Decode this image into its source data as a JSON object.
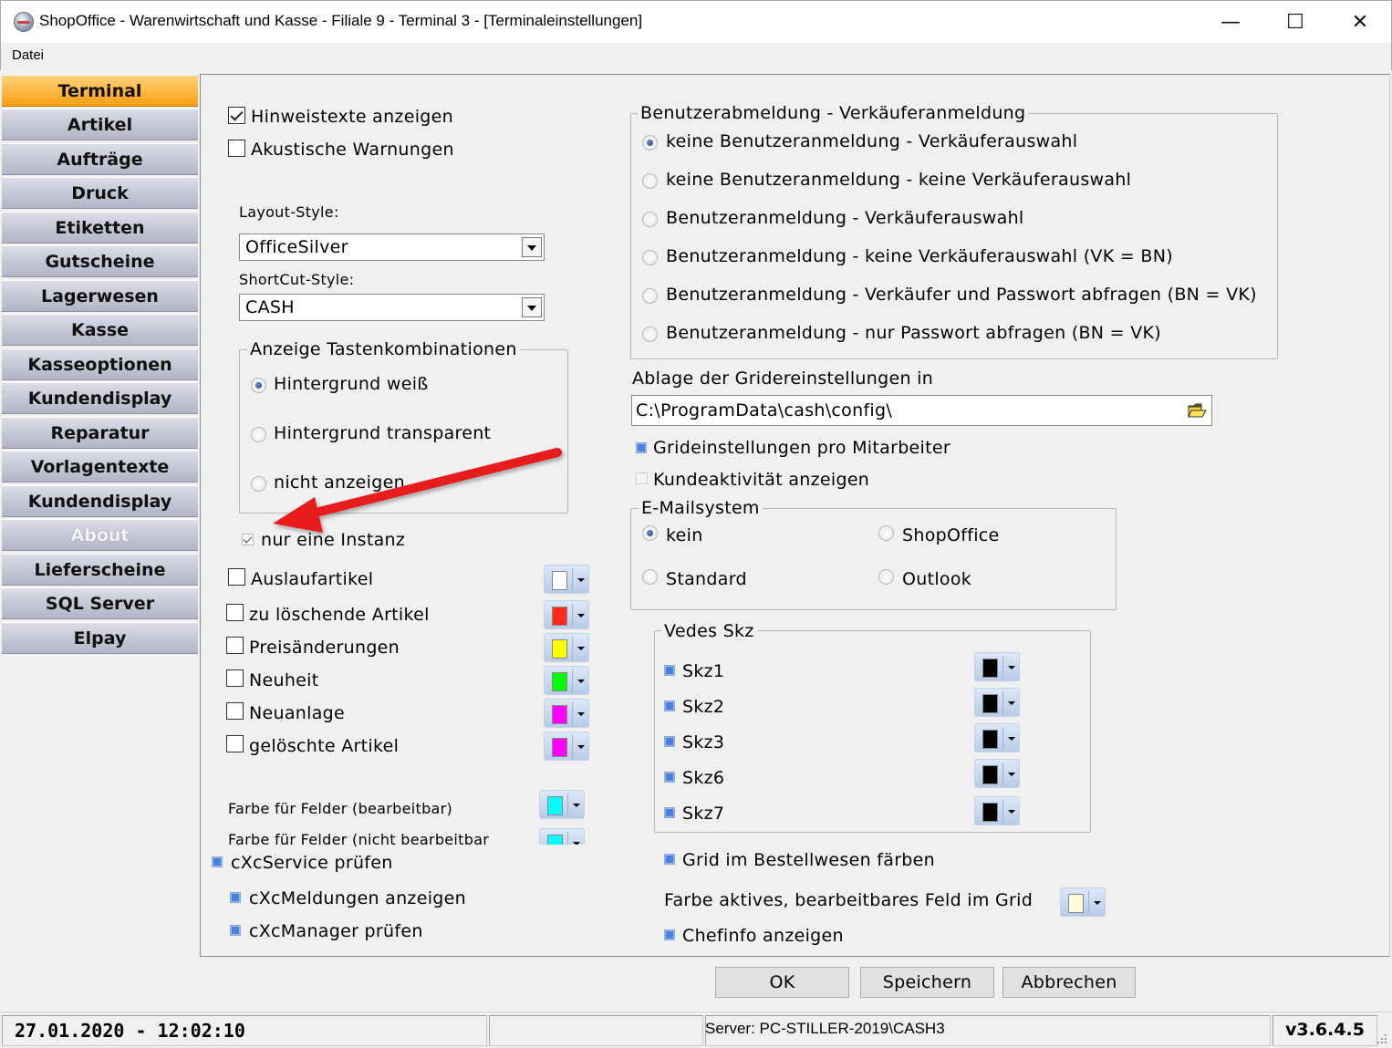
{
  "window": {
    "title": "ShopOffice - Warenwirtschaft und Kasse - Filiale 9 - Terminal 3 - [Terminaleinstellungen]",
    "minimize": "—",
    "maximize": "☐",
    "close": "✕"
  },
  "menu": {
    "datei": "Datei"
  },
  "sidebar": {
    "items": [
      {
        "label": "Terminal"
      },
      {
        "label": "Artikel"
      },
      {
        "label": "Aufträge"
      },
      {
        "label": "Druck"
      },
      {
        "label": "Etiketten"
      },
      {
        "label": "Gutscheine"
      },
      {
        "label": "Lagerwesen"
      },
      {
        "label": "Kasse"
      },
      {
        "label": "Kasseoptionen"
      },
      {
        "label": "Kundendisplay"
      },
      {
        "label": "Reparatur"
      },
      {
        "label": "Vorlagentexte"
      },
      {
        "label": "Kundendisplay"
      },
      {
        "label": "About"
      },
      {
        "label": "Lieferscheine"
      },
      {
        "label": "SQL Server"
      },
      {
        "label": "Elpay"
      }
    ]
  },
  "left": {
    "hinweistexte": "Hinweistexte anzeigen",
    "akustische": "Akustische Warnungen",
    "layout_label": "Layout-Style:",
    "layout_value": "OfficeSilver",
    "shortcut_label": "ShortCut-Style:",
    "shortcut_value": "CASH",
    "tasten_title": "Anzeige Tastenkombinationen",
    "tasten_opts": [
      "Hintergrund weiß",
      "Hintergrund transparent",
      "nicht anzeigen"
    ],
    "instanz": "nur eine Instanz",
    "colors": [
      {
        "label": "Auslaufartikel",
        "color": "#ffffff"
      },
      {
        "label": "zu löschende Artikel",
        "color": "#ff2a1a"
      },
      {
        "label": "Preisänderungen",
        "color": "#ffff00"
      },
      {
        "label": "Neuheit",
        "color": "#00ff00"
      },
      {
        "label": "Neuanlage",
        "color": "#ff00ff"
      },
      {
        "label": "gelöschte Artikel",
        "color": "#ff00ff"
      }
    ],
    "farbe_bearbeitbar": "Farbe für Felder (bearbeitbar)",
    "farbe_nicht": "Farbe für Felder (nicht bearbeitbar",
    "field_color": "#00ffff",
    "cxc_service": "cXcService prüfen",
    "cxc_meldungen": "cXcMeldungen anzeigen",
    "cxc_manager": "cXcManager prüfen"
  },
  "right": {
    "benutzer_title": "Benutzerabmeldung - Verkäuferanmeldung",
    "benutzer_opts": [
      "keine Benutzeranmeldung - Verkäuferauswahl",
      "keine Benutzeranmeldung - keine Verkäuferauswahl",
      "Benutzeranmeldung - Verkäuferauswahl",
      "Benutzeranmeldung - keine Verkäuferauswahl (VK = BN)",
      "Benutzeranmeldung - Verkäufer und Passwort abfragen (BN = VK)",
      "Benutzeranmeldung - nur Passwort abfragen (BN = VK)"
    ],
    "ablage_label": "Ablage der Gridereinstellungen in",
    "ablage_path": "C:\\ProgramData\\cash\\config\\",
    "grid_mitarbeiter": "Grideinstellungen pro Mitarbeiter",
    "kundeaktivitaet": "Kundeaktivität anzeigen",
    "email_title": "E-Mailsystem",
    "email_opts": [
      "kein",
      "ShopOffice",
      "Standard",
      "Outlook"
    ],
    "vedes_title": "Vedes Skz",
    "skz": [
      "Skz1",
      "Skz2",
      "Skz3",
      "Skz6",
      "Skz7"
    ],
    "skz_color": "#000000",
    "grid_bestell": "Grid im Bestellwesen färben",
    "farbe_aktiv": "Farbe aktives, bearbeitbares Feld im Grid",
    "aktiv_color": "#fffadc",
    "chefinfo": "Chefinfo anzeigen"
  },
  "buttons": {
    "ok": "OK",
    "speichern": "Speichern",
    "abbrechen": "Abbrechen"
  },
  "status": {
    "datetime": "27.01.2020 - 12:02:10",
    "server": "Server: PC-STILLER-2019\\CASH3",
    "version": "v3.6.4.5"
  },
  "accent": {
    "arrow": "#e81b1b",
    "active_tab": "#ffb640"
  }
}
